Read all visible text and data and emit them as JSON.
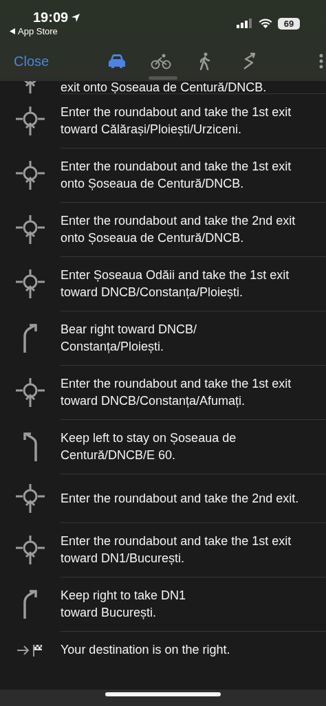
{
  "status_bar": {
    "time": "19:09",
    "back_label": "App Store",
    "battery": "69"
  },
  "nav": {
    "close": "Close",
    "modes": [
      {
        "kind": "car",
        "selected": true
      },
      {
        "kind": "bike",
        "selected": false
      },
      {
        "kind": "walk",
        "selected": false
      },
      {
        "kind": "ride",
        "selected": false
      }
    ]
  },
  "steps": [
    {
      "kind": "roundabout",
      "text": "exit onto Șoseaua de Centură/DNCB.",
      "partial": true
    },
    {
      "kind": "roundabout",
      "text": "Enter the roundabout and take the 1st exit toward Călărași/Ploiești/Urziceni."
    },
    {
      "kind": "roundabout",
      "text": "Enter the roundabout and take the 1st exit onto Șoseaua de Centură/DNCB."
    },
    {
      "kind": "roundabout",
      "text": "Enter the roundabout and take the 2nd exit onto Șoseaua de Centură/DNCB."
    },
    {
      "kind": "roundabout",
      "text": "Enter Șoseaua Odăii and take the 1st exit toward DNCB/Constanța/Ploiești."
    },
    {
      "kind": "bear_right",
      "text": "Bear right toward DNCB/\nConstanța/Ploiești."
    },
    {
      "kind": "roundabout",
      "text": "Enter the roundabout and take the 1st exit toward DNCB/Constanța/Afumați."
    },
    {
      "kind": "keep_left",
      "text": "Keep left to stay on Șoseaua de Centură/DNCB/E 60."
    },
    {
      "kind": "roundabout",
      "text": "Enter the roundabout and take the 2nd exit."
    },
    {
      "kind": "roundabout",
      "text": "Enter the roundabout and take the 1st exit toward DN1/București."
    },
    {
      "kind": "bear_right",
      "text": "Keep right to take DN1\ntoward București."
    },
    {
      "kind": "destination",
      "text": "Your destination is on the right."
    }
  ]
}
